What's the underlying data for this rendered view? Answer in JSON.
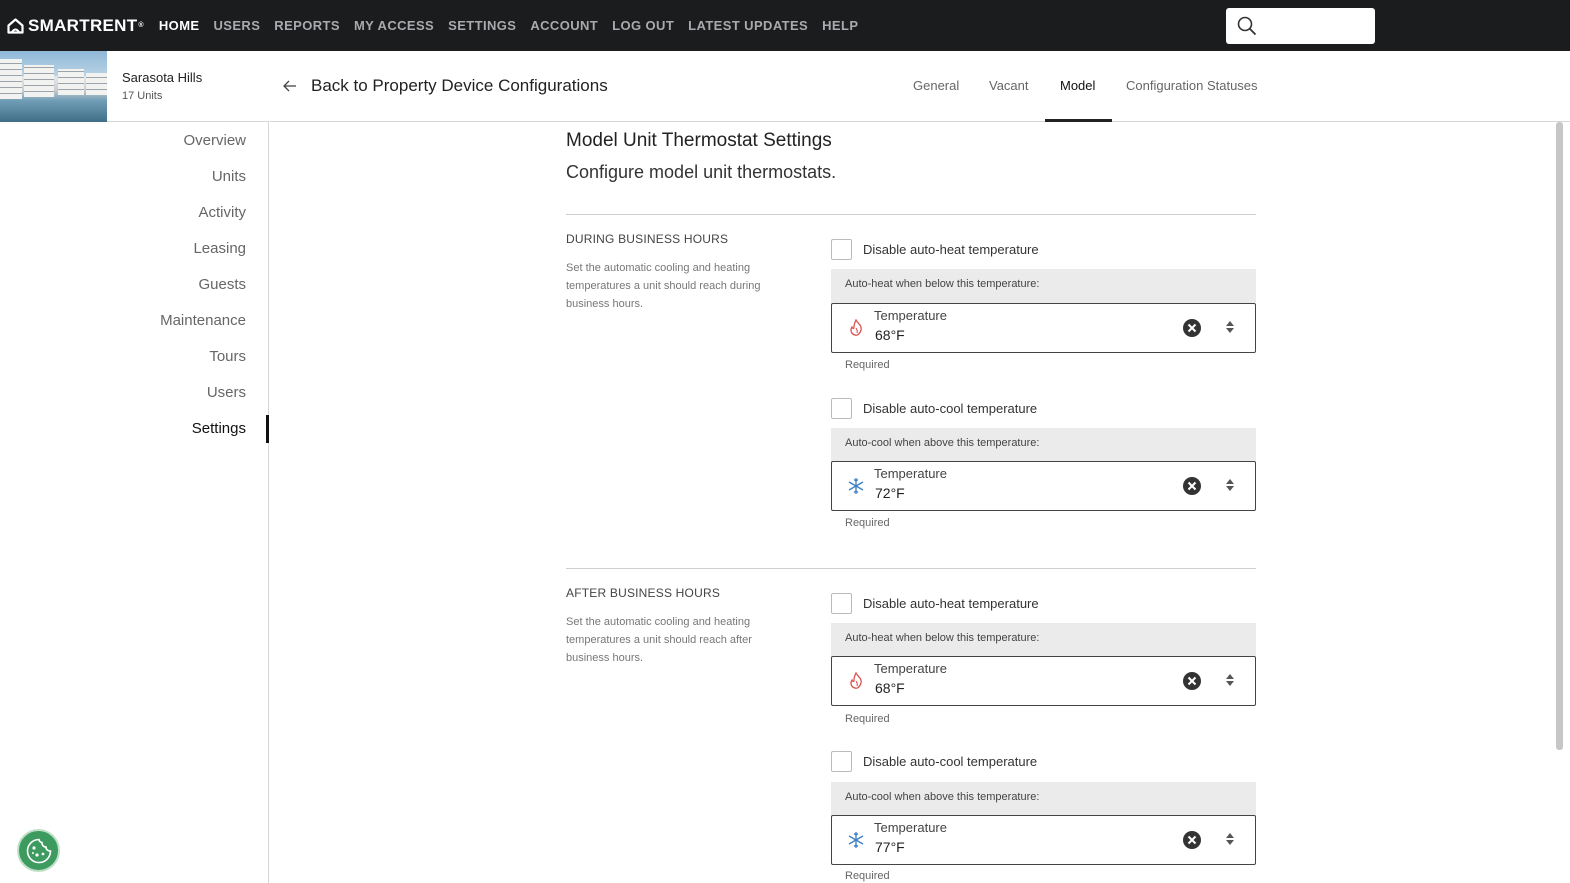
{
  "brand": {
    "name": "SMARTRENT",
    "tm": "®"
  },
  "nav": [
    "HOME",
    "USERS",
    "REPORTS",
    "MY ACCESS",
    "SETTINGS",
    "ACCOUNT",
    "LOG OUT",
    "LATEST UPDATES",
    "HELP"
  ],
  "nav_active": "HOME",
  "search": {
    "placeholder": ""
  },
  "property": {
    "name": "Sarasota Hills",
    "units": "17 Units"
  },
  "sidebar": {
    "items": [
      "Overview",
      "Units",
      "Activity",
      "Leasing",
      "Guests",
      "Maintenance",
      "Tours",
      "Users",
      "Settings"
    ],
    "active": "Settings"
  },
  "header": {
    "back_label": "Back to Property Device Configurations",
    "tabs": [
      "General",
      "Vacant",
      "Model",
      "Configuration Statuses"
    ],
    "active_tab": "Model"
  },
  "page": {
    "title": "Model Unit Thermostat Settings",
    "subtitle": "Configure model unit thermostats."
  },
  "sections": [
    {
      "title": "DURING BUSINESS HOURS",
      "description": "Set the automatic cooling and heating temperatures a unit should reach during business hours.",
      "heat": {
        "checkbox_label": "Disable auto-heat temperature",
        "checked": false,
        "field_header": "Auto-heat when below this temperature:",
        "field_label": "Temperature",
        "value": "68°F",
        "helper": "Required"
      },
      "cool": {
        "checkbox_label": "Disable auto-cool temperature",
        "checked": false,
        "field_header": "Auto-cool when above this temperature:",
        "field_label": "Temperature",
        "value": "72°F",
        "helper": "Required"
      }
    },
    {
      "title": "AFTER BUSINESS HOURS",
      "description": "Set the automatic cooling and heating temperatures a unit should reach after business hours.",
      "heat": {
        "checkbox_label": "Disable auto-heat temperature",
        "checked": false,
        "field_header": "Auto-heat when below this temperature:",
        "field_label": "Temperature",
        "value": "68°F",
        "helper": "Required"
      },
      "cool": {
        "checkbox_label": "Disable auto-cool temperature",
        "checked": false,
        "field_header": "Auto-cool when above this temperature:",
        "field_label": "Temperature",
        "value": "77°F",
        "helper": "Required"
      }
    }
  ],
  "colors": {
    "topbar": "#1b1c1e",
    "heat_icon": "#d9534f",
    "cool_icon": "#3a7fc1",
    "cookie_button": "#3e9b5f"
  }
}
